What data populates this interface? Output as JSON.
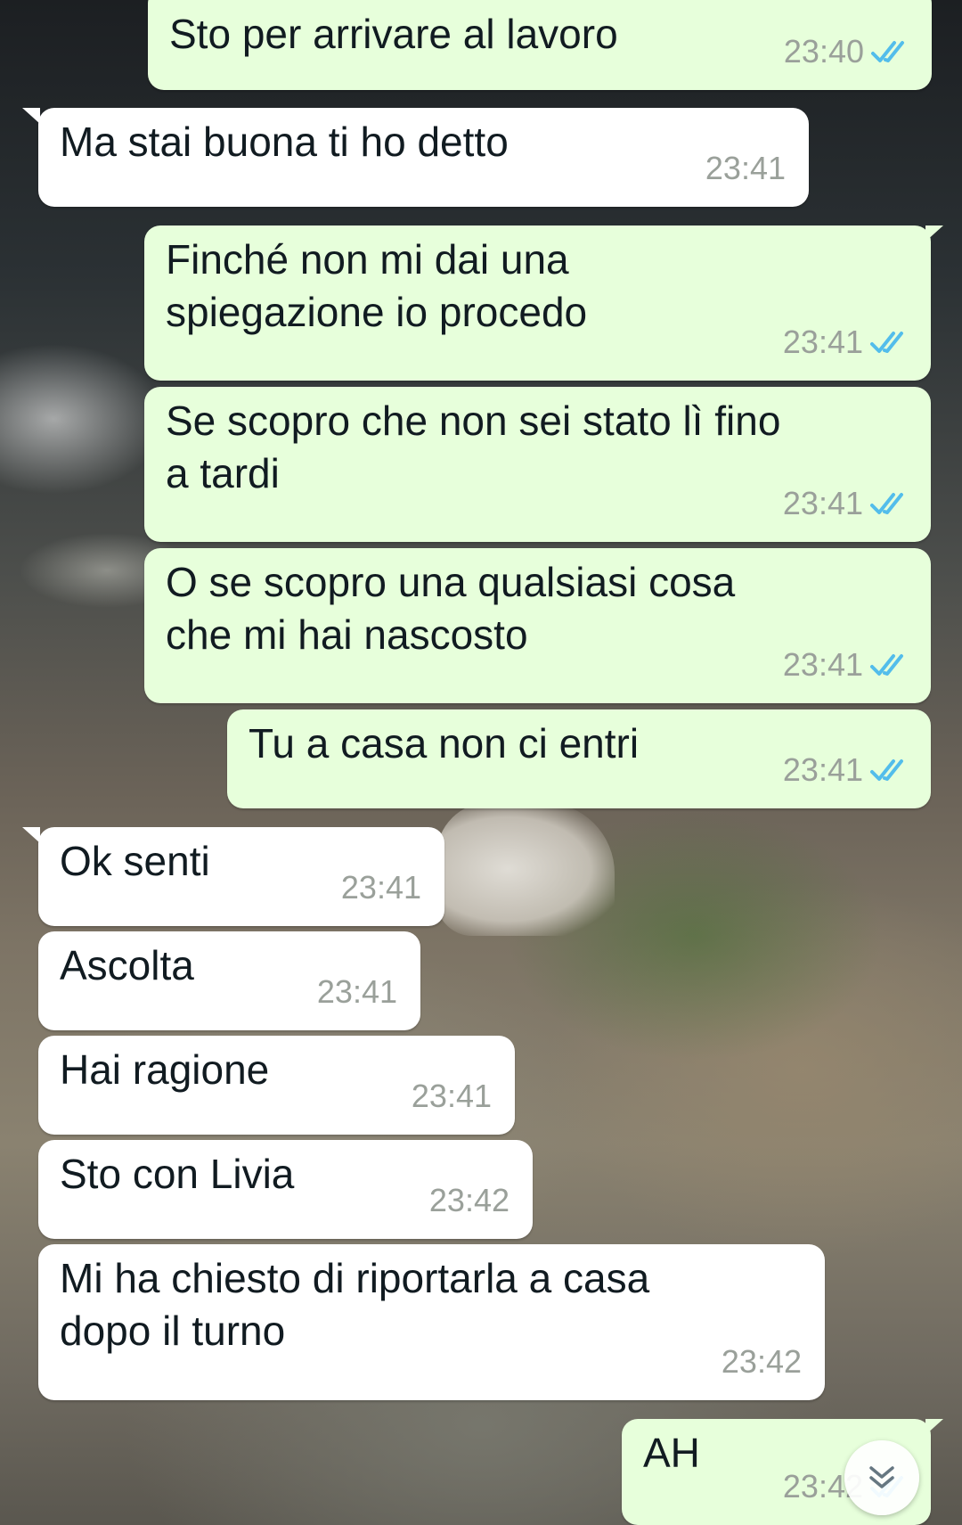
{
  "messages": [
    {
      "direction": "out",
      "text": "Sto per arrivare al lavoro",
      "time": "23:40",
      "status": "read"
    },
    {
      "direction": "in",
      "text": "Ma stai buona ti ho detto",
      "time": "23:41"
    },
    {
      "direction": "out",
      "text": "Finché non mi dai una\nspiegazione io procedo",
      "time": "23:41",
      "status": "read"
    },
    {
      "direction": "out",
      "text": "Se scopro che non sei stato lì fino\na tardi",
      "time": "23:41",
      "status": "read"
    },
    {
      "direction": "out",
      "text": "O se scopro una qualsiasi cosa\nche mi hai nascosto",
      "time": "23:41",
      "status": "read"
    },
    {
      "direction": "out",
      "text": "Tu a casa non ci entri",
      "time": "23:41",
      "status": "read"
    },
    {
      "direction": "in",
      "text": "Ok senti",
      "time": "23:41"
    },
    {
      "direction": "in",
      "text": "Ascolta",
      "time": "23:41"
    },
    {
      "direction": "in",
      "text": "Hai ragione",
      "time": "23:41"
    },
    {
      "direction": "in",
      "text": "Sto con Livia",
      "time": "23:42"
    },
    {
      "direction": "in",
      "text": "Mi ha chiesto di riportarla a casa\ndopo il turno",
      "time": "23:42"
    },
    {
      "direction": "out",
      "text": "AH",
      "time": "23:42",
      "status": "read"
    }
  ],
  "colors": {
    "outgoing_bubble": "#e7ffdb",
    "incoming_bubble": "#ffffff",
    "read_ticks": "#53bdeb",
    "timestamp": "#9aa09a"
  },
  "icons": {
    "read_receipt": "double-check-icon",
    "scroll_down": "chevron-down-icon"
  }
}
